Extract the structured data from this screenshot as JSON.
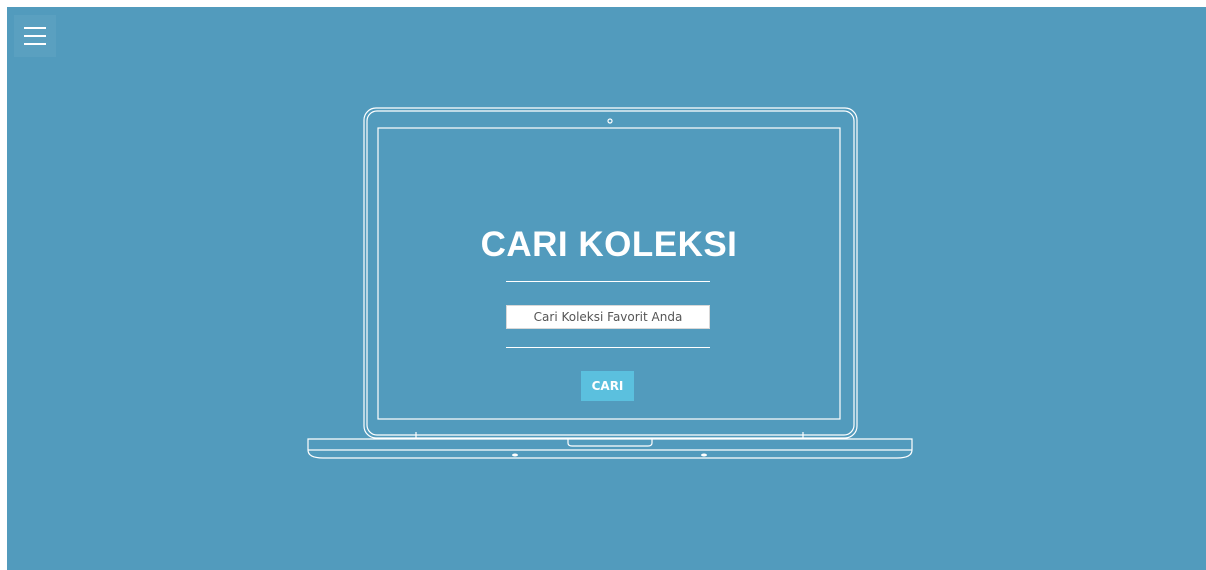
{
  "icons": {
    "menu": "hamburger-menu-icon"
  },
  "hero": {
    "title": "CARI KOLEKSI",
    "search": {
      "placeholder": "Cari Koleksi Favorit Anda",
      "value": ""
    },
    "button_label": "CARI"
  },
  "colors": {
    "background": "#529bbd",
    "accent_button": "#5bc0de",
    "foreground": "#ffffff"
  }
}
